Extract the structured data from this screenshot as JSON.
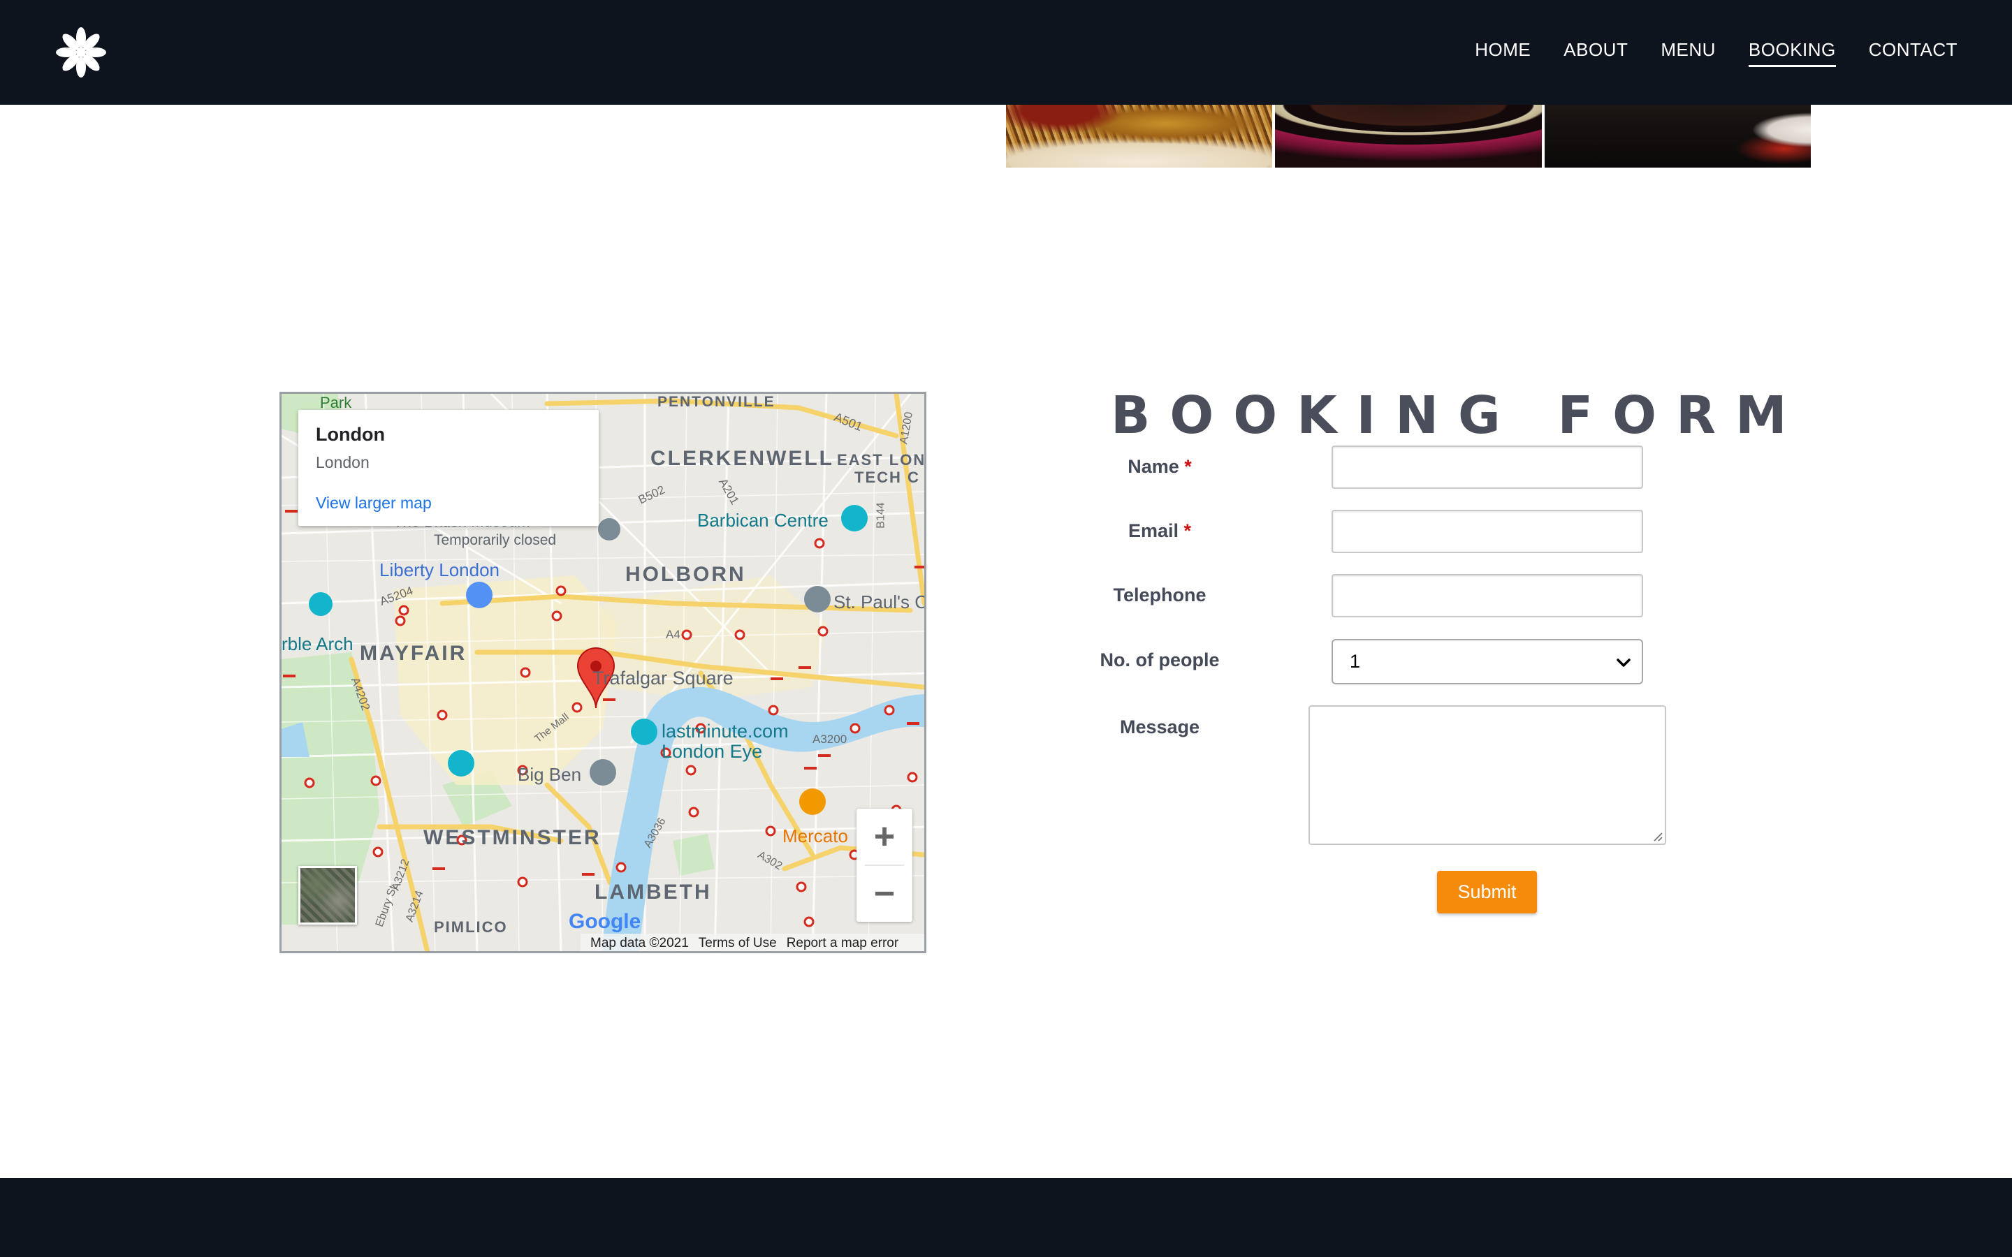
{
  "nav": {
    "items": [
      {
        "label": "HOME"
      },
      {
        "label": "ABOUT"
      },
      {
        "label": "MENU"
      },
      {
        "label": "BOOKING",
        "active": true
      },
      {
        "label": "CONTACT"
      }
    ]
  },
  "map": {
    "card": {
      "title": "London",
      "subtitle": "London",
      "link": "View larger map"
    },
    "labels": {
      "pentonville": "PENTONVILLE",
      "clerkenwell": "CLERKENWELL",
      "east_london": "EAST LON",
      "tech_city": "TECH C",
      "park": "Park",
      "british_museum": "The British Museum",
      "temporarily_closed": "Temporarily closed",
      "barbican": "Barbican Centre",
      "liberty": "Liberty London",
      "holborn": "HOLBORN",
      "st_pauls": "St. Paul's C",
      "marble_arch": "rble Arch",
      "mayfair": "MAYFAIR",
      "trafalgar": "Trafalgar Square",
      "lastminute": "lastminute.com",
      "london_eye": "London Eye",
      "big_ben": "Big Ben",
      "mercato": "Mercato",
      "westminster": "WESTMINSTER",
      "lambeth": "LAMBETH",
      "pimlico": "PIMLICO",
      "the_mall": "The Mall",
      "google": "Google",
      "roads": {
        "a501": "A501",
        "a1200": "A1200",
        "b502": "B502",
        "a201": "A201",
        "b144": "B144",
        "a5204": "A5204",
        "a4": "A4",
        "a4202": "A4202",
        "a3200": "A3200",
        "a3036": "A3036",
        "a302": "A302",
        "a3212": "A3212",
        "a3214": "A3214",
        "ebury": "Ebury St"
      }
    },
    "attribution": {
      "data": "Map data ©2021",
      "terms": "Terms of Use",
      "report": "Report a map error"
    },
    "zoom_in": "+",
    "zoom_out": "−"
  },
  "form": {
    "title": "BOOKING FORM",
    "required_mark": "*",
    "name_label": "Name",
    "email_label": "Email",
    "telephone_label": "Telephone",
    "people_label": "No. of people",
    "people_value": "1",
    "message_label": "Message",
    "submit_label": "Submit"
  },
  "colors": {
    "nav_bg": "#0e141d",
    "accent": "#f58a0b",
    "title": "#4a4d5a",
    "required": "#d01010",
    "map_link": "#1a73e8"
  }
}
